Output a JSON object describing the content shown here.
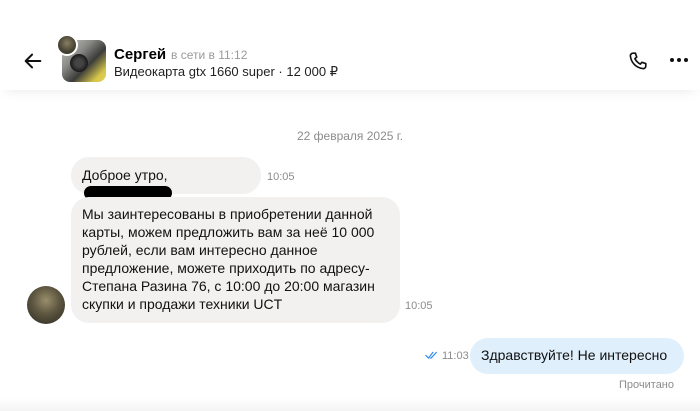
{
  "header": {
    "back_icon": "arrow-left-icon",
    "contact_name": "Сергей",
    "status": "в сети в 11:12",
    "listing": "Видеокарта gtx 1660 super · 12 000 ₽",
    "call_icon": "phone-icon",
    "more_icon": "more-horizontal-icon"
  },
  "chat": {
    "date": "22 февраля 2025 г.",
    "messages": [
      {
        "direction": "incoming",
        "text": "Доброе утро,",
        "redacted": true,
        "time": "10:05"
      },
      {
        "direction": "incoming",
        "text": "Мы заинтересованы в приобретении данной\nкарты, можем предложить вам за неё 10 000\nрублей, если вам интересно данное\nпредложение, можете приходить по адресу-\nСтепана Разина 76, с 10:00 до 20:00 магазин\nскупки и продажи техники UCT",
        "time": "10:05"
      },
      {
        "direction": "outgoing",
        "text": "Здравствуйте! Не интересно",
        "time": "11:03",
        "status": "Прочитано"
      }
    ]
  },
  "colors": {
    "incoming_bubble": "#f2f1f0",
    "outgoing_bubble": "#dfeffc",
    "muted_text": "#8c8c8c",
    "read_check": "#2f8cf0"
  }
}
